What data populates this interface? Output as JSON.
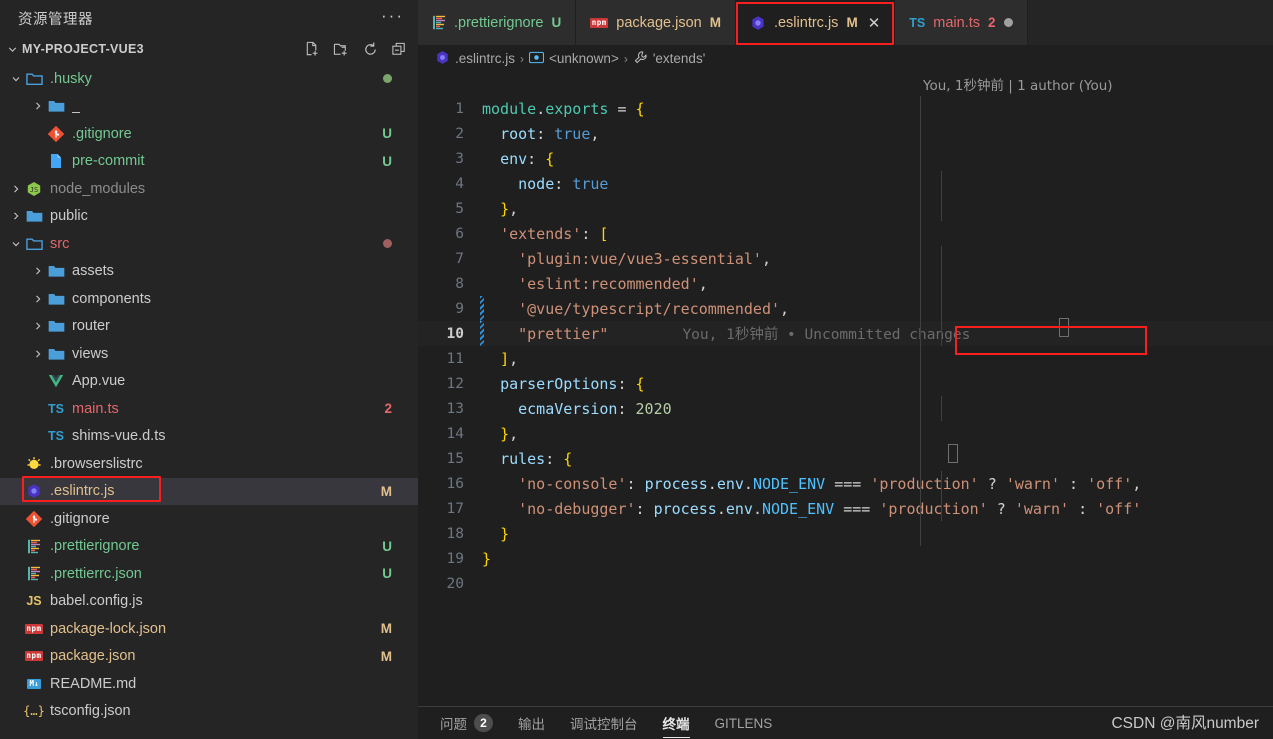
{
  "sidebar": {
    "title": "资源管理器",
    "more_label": "···",
    "project_name": "MY-PROJECT-VUE3",
    "actions": [
      {
        "name": "new-file-icon",
        "label": "新建文件"
      },
      {
        "name": "new-folder-icon",
        "label": "新建文件夹"
      },
      {
        "name": "refresh-icon",
        "label": "刷新"
      },
      {
        "name": "collapse-all-icon",
        "label": "全部折叠"
      }
    ],
    "items": [
      {
        "label": ".husky",
        "icon": "folder-open",
        "depth": 0,
        "expanded": true,
        "color": "green",
        "badge": "",
        "dot": "#7aa66b"
      },
      {
        "label": "_",
        "icon": "folder",
        "depth": 1,
        "expanded": false,
        "color": "grey",
        "badge": "",
        "dot": ""
      },
      {
        "label": ".gitignore",
        "icon": "git",
        "depth": 1,
        "expanded": null,
        "color": "green",
        "badge": "U",
        "dot": ""
      },
      {
        "label": "pre-commit",
        "icon": "file-blue",
        "depth": 1,
        "expanded": null,
        "color": "green",
        "badge": "U",
        "dot": ""
      },
      {
        "label": "node_modules",
        "icon": "node",
        "depth": 0,
        "expanded": false,
        "color": "dim",
        "badge": "",
        "dot": ""
      },
      {
        "label": "public",
        "icon": "folder",
        "depth": 0,
        "expanded": false,
        "color": "grey",
        "badge": "",
        "dot": ""
      },
      {
        "label": "src",
        "icon": "folder-open",
        "depth": 0,
        "expanded": true,
        "color": "red",
        "badge": "",
        "dot": "#a06060"
      },
      {
        "label": "assets",
        "icon": "folder",
        "depth": 1,
        "expanded": false,
        "color": "grey",
        "badge": "",
        "dot": ""
      },
      {
        "label": "components",
        "icon": "folder",
        "depth": 1,
        "expanded": false,
        "color": "grey",
        "badge": "",
        "dot": ""
      },
      {
        "label": "router",
        "icon": "folder",
        "depth": 1,
        "expanded": false,
        "color": "grey",
        "badge": "",
        "dot": ""
      },
      {
        "label": "views",
        "icon": "folder",
        "depth": 1,
        "expanded": false,
        "color": "grey",
        "badge": "",
        "dot": ""
      },
      {
        "label": "App.vue",
        "icon": "vue",
        "depth": 1,
        "expanded": null,
        "color": "grey",
        "badge": "",
        "dot": ""
      },
      {
        "label": "main.ts",
        "icon": "ts",
        "depth": 1,
        "expanded": null,
        "color": "red",
        "badge": "2",
        "dot": ""
      },
      {
        "label": "shims-vue.d.ts",
        "icon": "ts",
        "depth": 1,
        "expanded": null,
        "color": "grey",
        "badge": "",
        "dot": ""
      },
      {
        "label": ".browserslistrc",
        "icon": "browserslist",
        "depth": 0,
        "expanded": null,
        "color": "grey",
        "badge": "",
        "dot": ""
      },
      {
        "label": ".eslintrc.js",
        "icon": "eslint",
        "depth": 0,
        "expanded": null,
        "color": "orange",
        "badge": "M",
        "dot": "",
        "selected": true,
        "highlighted": true
      },
      {
        "label": ".gitignore",
        "icon": "git",
        "depth": 0,
        "expanded": null,
        "color": "grey",
        "badge": "",
        "dot": ""
      },
      {
        "label": ".prettierignore",
        "icon": "prettier",
        "depth": 0,
        "expanded": null,
        "color": "green",
        "badge": "U",
        "dot": ""
      },
      {
        "label": ".prettierrc.json",
        "icon": "prettier",
        "depth": 0,
        "expanded": null,
        "color": "green",
        "badge": "U",
        "dot": ""
      },
      {
        "label": "babel.config.js",
        "icon": "js",
        "depth": 0,
        "expanded": null,
        "color": "grey",
        "badge": "",
        "dot": ""
      },
      {
        "label": "package-lock.json",
        "icon": "npm",
        "depth": 0,
        "expanded": null,
        "color": "orange",
        "badge": "M",
        "dot": ""
      },
      {
        "label": "package.json",
        "icon": "npm",
        "depth": 0,
        "expanded": null,
        "color": "orange",
        "badge": "M",
        "dot": ""
      },
      {
        "label": "README.md",
        "icon": "md",
        "depth": 0,
        "expanded": null,
        "color": "grey",
        "badge": "",
        "dot": ""
      },
      {
        "label": "tsconfig.json",
        "icon": "json",
        "depth": 0,
        "expanded": null,
        "color": "grey",
        "badge": "",
        "dot": ""
      }
    ]
  },
  "tabs": [
    {
      "label": ".prettierignore",
      "icon": "prettier",
      "mark": "U",
      "mark_color": "#73c991",
      "name_color": "#73c991",
      "active": false,
      "close": false,
      "dirty": false
    },
    {
      "label": "package.json",
      "icon": "npm",
      "mark": "M",
      "mark_color": "#e2c08d",
      "name_color": "#e2c08d",
      "active": false,
      "close": false,
      "dirty": false
    },
    {
      "label": ".eslintrc.js",
      "icon": "eslint",
      "mark": "M",
      "mark_color": "#e2c08d",
      "name_color": "#e2c08d",
      "active": true,
      "close": true,
      "dirty": false,
      "close_label": "✕",
      "highlighted": true
    },
    {
      "label": "main.ts",
      "icon": "ts",
      "mark": "2",
      "mark_color": "#e4676b",
      "name_color": "#e4676b",
      "active": false,
      "close": false,
      "dirty": true
    }
  ],
  "breadcrumb": {
    "file": ".eslintrc.js",
    "symbol": "<unknown>",
    "member": "'extends'",
    "separator": "›"
  },
  "blame_header": "You, 1秒钟前 | 1 author (You)",
  "editor": {
    "inline_blame": "You, 1秒钟前 • Uncommitted changes",
    "current_line": 10,
    "lines": [
      {
        "n": 1,
        "text": "module.exports = {"
      },
      {
        "n": 2,
        "text": "  root: true,"
      },
      {
        "n": 3,
        "text": "  env: {"
      },
      {
        "n": 4,
        "text": "    node: true"
      },
      {
        "n": 5,
        "text": "  },"
      },
      {
        "n": 6,
        "text": "  'extends': ["
      },
      {
        "n": 7,
        "text": "    'plugin:vue/vue3-essential',"
      },
      {
        "n": 8,
        "text": "    'eslint:recommended',"
      },
      {
        "n": 9,
        "text": "    '@vue/typescript/recommended',"
      },
      {
        "n": 10,
        "text": "    \"prettier\""
      },
      {
        "n": 11,
        "text": "  ],"
      },
      {
        "n": 12,
        "text": "  parserOptions: {"
      },
      {
        "n": 13,
        "text": "    ecmaVersion: 2020"
      },
      {
        "n": 14,
        "text": "  },"
      },
      {
        "n": 15,
        "text": "  rules: {"
      },
      {
        "n": 16,
        "text": "    'no-console': process.env.NODE_ENV === 'production' ? 'warn' : 'off',"
      },
      {
        "n": 17,
        "text": "    'no-debugger': process.env.NODE_ENV === 'production' ? 'warn' : 'off'"
      },
      {
        "n": 18,
        "text": "  }"
      },
      {
        "n": 19,
        "text": "}"
      },
      {
        "n": 20,
        "text": ""
      }
    ]
  },
  "panel": {
    "tabs": [
      {
        "label": "问题",
        "count": "2",
        "active": false
      },
      {
        "label": "输出",
        "count": "",
        "active": false
      },
      {
        "label": "调试控制台",
        "count": "",
        "active": false
      },
      {
        "label": "终端",
        "count": "",
        "active": true
      },
      {
        "label": "GITLENS",
        "count": "",
        "active": false
      }
    ]
  },
  "watermark": "CSDN @南风number",
  "colors": {
    "sidebar_bg": "#252526",
    "editor_bg": "#1f1f1f",
    "tab_active_bg": "#1f1f1f",
    "tab_inactive_bg": "#2d2d2d",
    "row_selected_bg": "#37373d",
    "highlight_red": "#fa1e1e",
    "modified_orange": "#e2c08d",
    "untracked_green": "#73c991",
    "error_red": "#e4676b"
  }
}
